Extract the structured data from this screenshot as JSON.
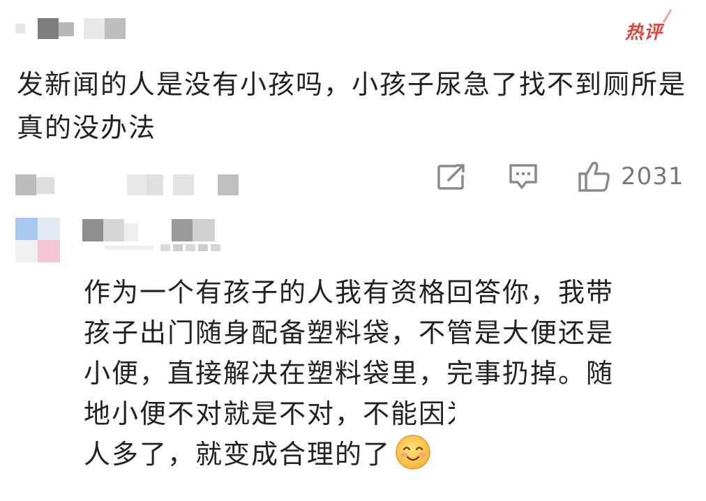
{
  "comment": {
    "badge": "热评",
    "text": "发新闻的人是没有小孩吗，小孩子尿急了找不到厕所是真的没办法",
    "actions": {
      "share_icon": "share-icon",
      "comment_icon": "comment-icon",
      "like_icon": "thumbs-up-icon",
      "like_count": "2031"
    }
  },
  "reply": {
    "lines": [
      "作为一个有孩子的人我有资格回答你，我带",
      "孩子出门随身配备塑料袋，不管是大便还是",
      "小便，直接解决在塑料袋里，完事扔掉。随",
      "地小便不对就是不对，不能因为",
      "人多了，就变成合理的了"
    ],
    "line4_visible": "地小便不对就是不对，不能因",
    "line4_cut": "为",
    "emoji": "smiling-face-emoji"
  },
  "colors": {
    "badge": "#e0453a",
    "text": "#222222",
    "icon": "#8a8a8a"
  }
}
